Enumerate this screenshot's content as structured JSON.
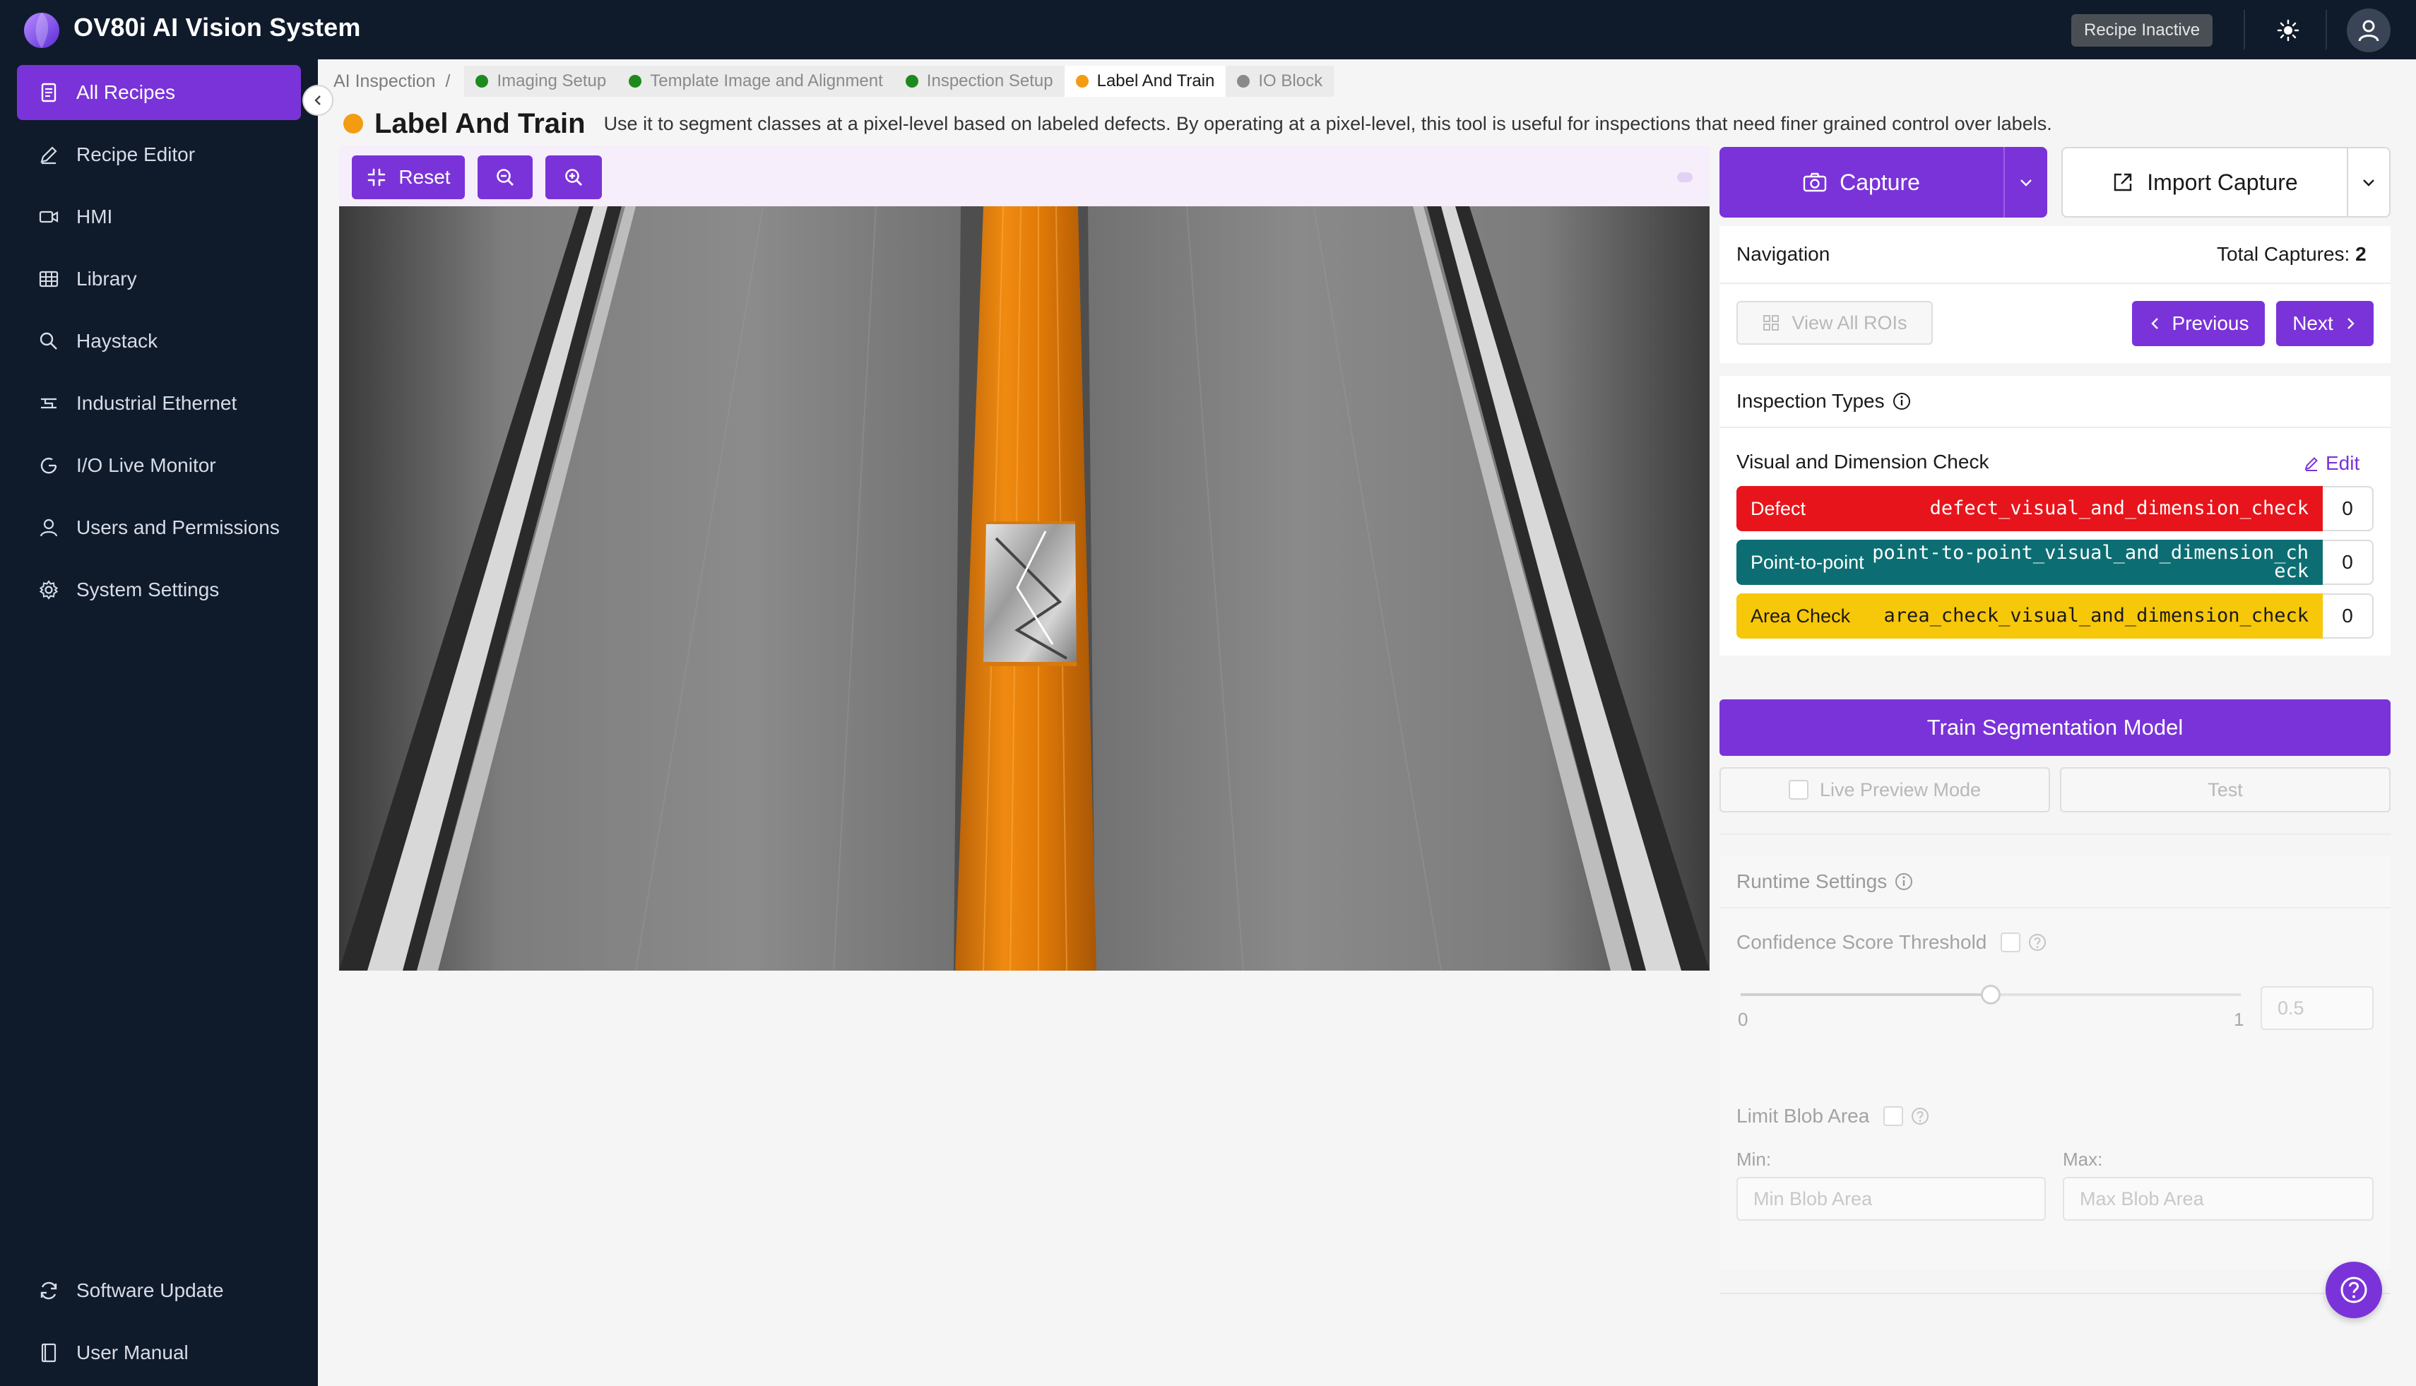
{
  "header": {
    "app_title": "OV80i AI Vision System",
    "recipe_status": "Recipe Inactive",
    "theme_icon": "sun-icon",
    "avatar_icon": "user-icon"
  },
  "sidebar": {
    "items": [
      {
        "label": "All Recipes",
        "icon": "document-icon",
        "active": true
      },
      {
        "label": "Recipe Editor",
        "icon": "pencil-icon"
      },
      {
        "label": "HMI",
        "icon": "video-icon"
      },
      {
        "label": "Library",
        "icon": "grid-icon"
      },
      {
        "label": "Haystack",
        "icon": "search-icon"
      },
      {
        "label": "Industrial Ethernet",
        "icon": "network-icon"
      },
      {
        "label": "I/O Live Monitor",
        "icon": "gauge-icon"
      },
      {
        "label": "Users and Permissions",
        "icon": "user-icon"
      },
      {
        "label": "System Settings",
        "icon": "gear-icon"
      }
    ],
    "bottom_items": [
      {
        "label": "Software Update",
        "icon": "refresh-icon"
      },
      {
        "label": "User Manual",
        "icon": "book-icon"
      }
    ]
  },
  "breadcrumb": {
    "root": "AI Inspection",
    "separator": "/",
    "steps": [
      {
        "label": "Imaging Setup",
        "color": "#1e8a1e"
      },
      {
        "label": "Template Image and Alignment",
        "color": "#1e8a1e"
      },
      {
        "label": "Inspection Setup",
        "color": "#1e8a1e"
      },
      {
        "label": "Label And Train",
        "color": "#f39c12",
        "current": true
      },
      {
        "label": "IO Block",
        "color": "#8a8a8a"
      }
    ]
  },
  "page": {
    "title": "Label And Train",
    "description": "Use it to segment classes at a pixel-level based on labeled defects. By operating at a pixel-level, this tool is useful for inspections that need finer grained control over labels."
  },
  "toolbar": {
    "reset_label": "Reset",
    "zoom_out_icon": "zoom-out-icon",
    "zoom_in_icon": "zoom-in-icon"
  },
  "capture": {
    "capture_label": "Capture",
    "import_label": "Import Capture"
  },
  "navigation": {
    "title": "Navigation",
    "total_label": "Total Captures:",
    "total_value": "2",
    "view_all_label": "View All ROIs",
    "previous_label": "Previous",
    "next_label": "Next"
  },
  "inspection_types": {
    "title": "Inspection Types",
    "check_name": "Visual and Dimension Check",
    "edit_label": "Edit",
    "classes": [
      {
        "name": "Defect",
        "key": "defect_visual_and_dimension_check",
        "count": "0",
        "color": "#e8141b",
        "text_color": "#ffffff"
      },
      {
        "name": "Point-to-point",
        "key": "point-to-point_visual_and_dimension_check",
        "count": "0",
        "color": "#0c6e73",
        "text_color": "#ffffff"
      },
      {
        "name": "Area Check",
        "key": "area_check_visual_and_dimension_check",
        "count": "0",
        "color": "#f7c70a",
        "text_color": "#1a1a1a"
      }
    ]
  },
  "train": {
    "train_label": "Train Segmentation Model",
    "live_preview_label": "Live Preview Mode",
    "test_label": "Test"
  },
  "runtime": {
    "title": "Runtime Settings",
    "confidence_label": "Confidence Score Threshold",
    "slider_min": "0",
    "slider_max": "1",
    "slider_value": 0.5,
    "threshold_placeholder": "0.5",
    "limit_blob_label": "Limit Blob Area",
    "min_label": "Min:",
    "max_label": "Max:",
    "min_placeholder": "Min Blob Area",
    "max_placeholder": "Max Blob Area"
  },
  "colors": {
    "accent": "#7a33d8",
    "sidebar_bg": "#0f1a2b",
    "status_orange": "#f39c12",
    "status_green": "#1e8a1e"
  }
}
